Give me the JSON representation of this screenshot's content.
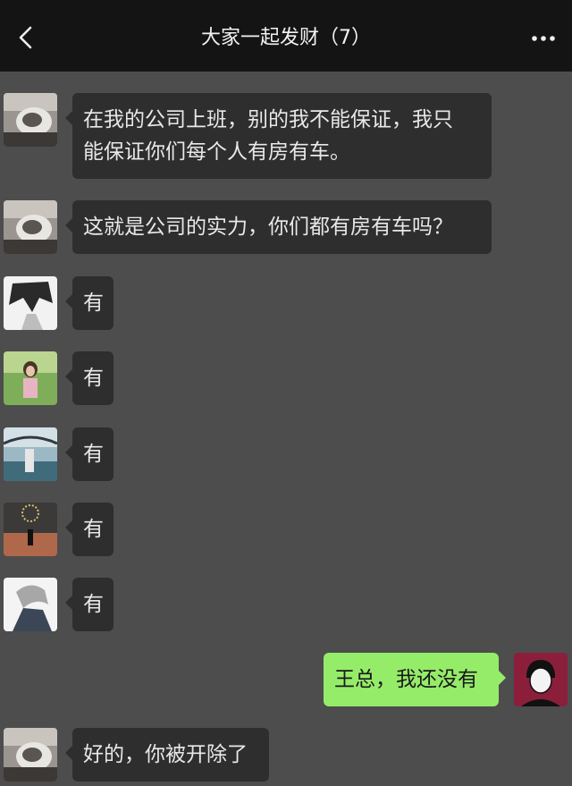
{
  "header": {
    "title": "大家一起发财（7）",
    "back_icon": "chevron-left-icon",
    "more_icon": "more-dots-icon"
  },
  "messages": [
    {
      "sender": "boss",
      "text_lines": [
        "在我的公司上班，别的我不能保证，我只",
        "能保证你们每个人有房有车。"
      ]
    },
    {
      "sender": "boss",
      "text_lines": [
        "这就是公司的实力，你们都有房有车吗？"
      ]
    },
    {
      "sender": "member1",
      "text_lines": [
        "有"
      ]
    },
    {
      "sender": "member2",
      "text_lines": [
        "有"
      ]
    },
    {
      "sender": "member3",
      "text_lines": [
        "有"
      ]
    },
    {
      "sender": "member4",
      "text_lines": [
        "有"
      ]
    },
    {
      "sender": "member5",
      "text_lines": [
        "有"
      ]
    },
    {
      "sender": "me",
      "text_lines": [
        "王总，我还没有"
      ]
    },
    {
      "sender": "boss",
      "text_lines": [
        "好的，你被开除了"
      ]
    }
  ],
  "colors": {
    "chat_background": "#4d4d4d",
    "incoming_bubble": "#2e2e2e",
    "outgoing_bubble": "#95ec69",
    "header_background": "#141414"
  }
}
